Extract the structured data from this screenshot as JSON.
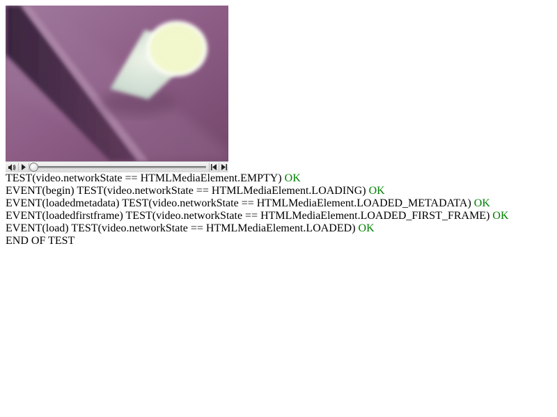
{
  "video": {
    "content": "blurry white paper cup on a purple surface",
    "controls": {
      "mute_icon": "speaker-icon",
      "play_icon": "play-icon",
      "back_icon": "rewind-icon",
      "forward_icon": "fast-forward-icon",
      "position": 0.0
    }
  },
  "log": [
    {
      "text": "TEST(video.networkState == HTMLMediaElement.EMPTY)",
      "status": "OK"
    },
    {
      "text": "EVENT(begin) TEST(video.networkState == HTMLMediaElement.LOADING)",
      "status": "OK"
    },
    {
      "text": "EVENT(loadedmetadata) TEST(video.networkState == HTMLMediaElement.LOADED_METADATA)",
      "status": "OK"
    },
    {
      "text": "EVENT(loadedfirstframe) TEST(video.networkState == HTMLMediaElement.LOADED_FIRST_FRAME)",
      "status": "OK"
    },
    {
      "text": "EVENT(load) TEST(video.networkState == HTMLMediaElement.LOADED)",
      "status": "OK"
    }
  ],
  "end_text": "END OF TEST",
  "colors": {
    "ok": "#008000",
    "text": "#000000"
  }
}
